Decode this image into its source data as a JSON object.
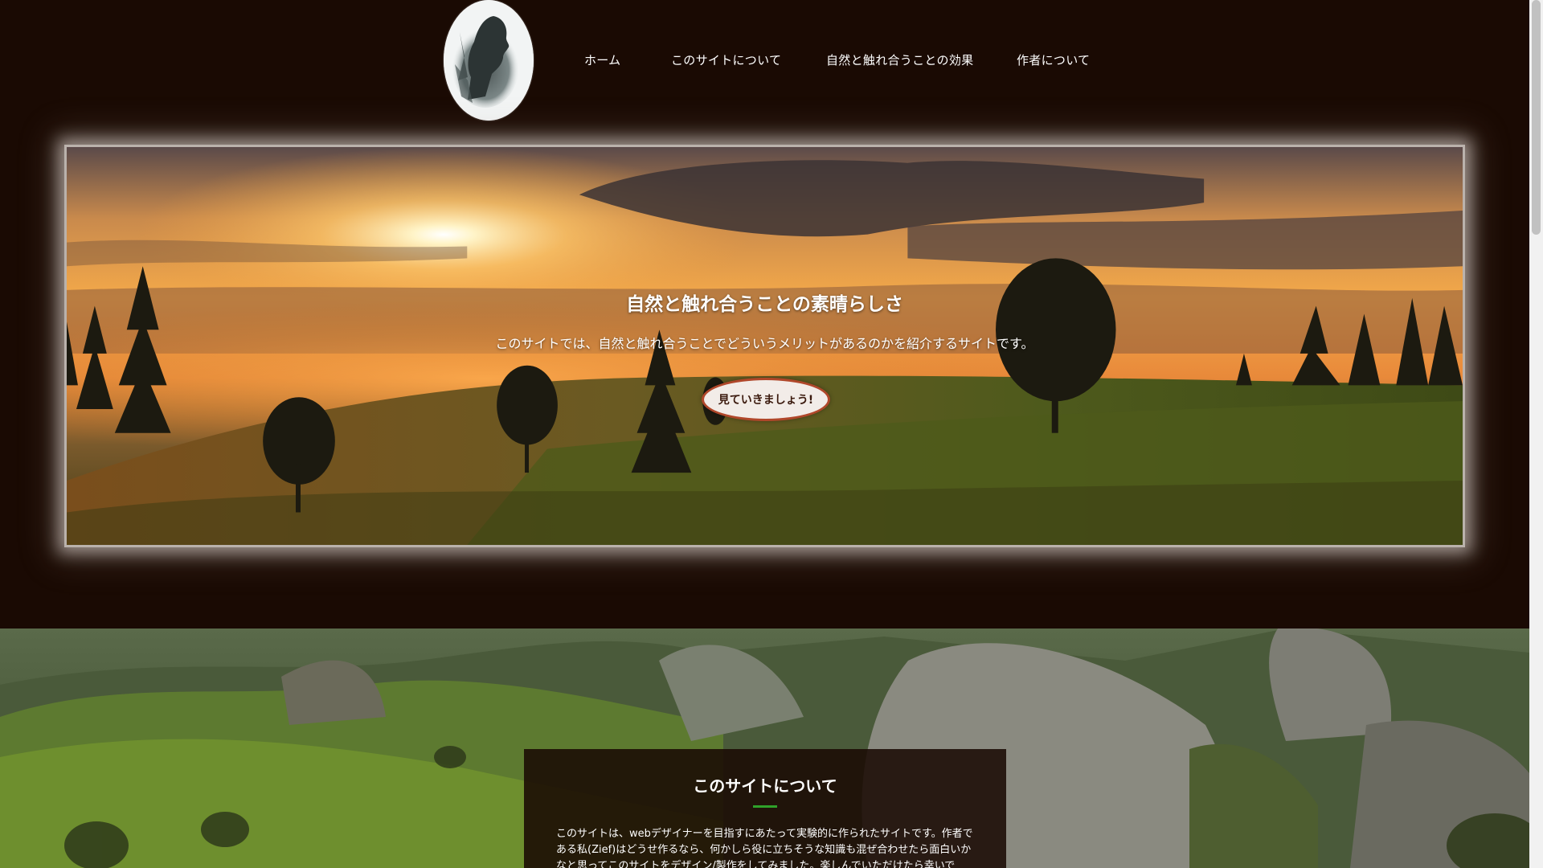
{
  "header": {
    "logo_icon": "portrait-logo-icon",
    "nav": [
      {
        "label": "ホーム"
      },
      {
        "label": "このサイトについて"
      },
      {
        "label": "自然と触れ合うことの効果"
      },
      {
        "label": "作者について"
      }
    ]
  },
  "hero": {
    "title": "自然と触れ合うことの素晴らしさ",
    "subtitle": "このサイトでは、自然と触れ合うことでどういうメリットがあるのかを紹介するサイトです。",
    "button_label": "見ていきましょう!"
  },
  "about": {
    "title": "このサイトについて",
    "text": "このサイトは、webデザイナーを目指すにあたって実験的に作られたサイトです。作者である私(Zief)はどうせ作るなら、何かしら役に立ちそうな知識も混ぜ合わせたら面白いかなと思ってこのサイトをデザイン/製作をしてみました。楽しんでいただけたら幸いです。"
  },
  "colors": {
    "page_background": "#1a0a03",
    "accent_underline": "#2fa12a",
    "button_border": "#b0472a"
  }
}
